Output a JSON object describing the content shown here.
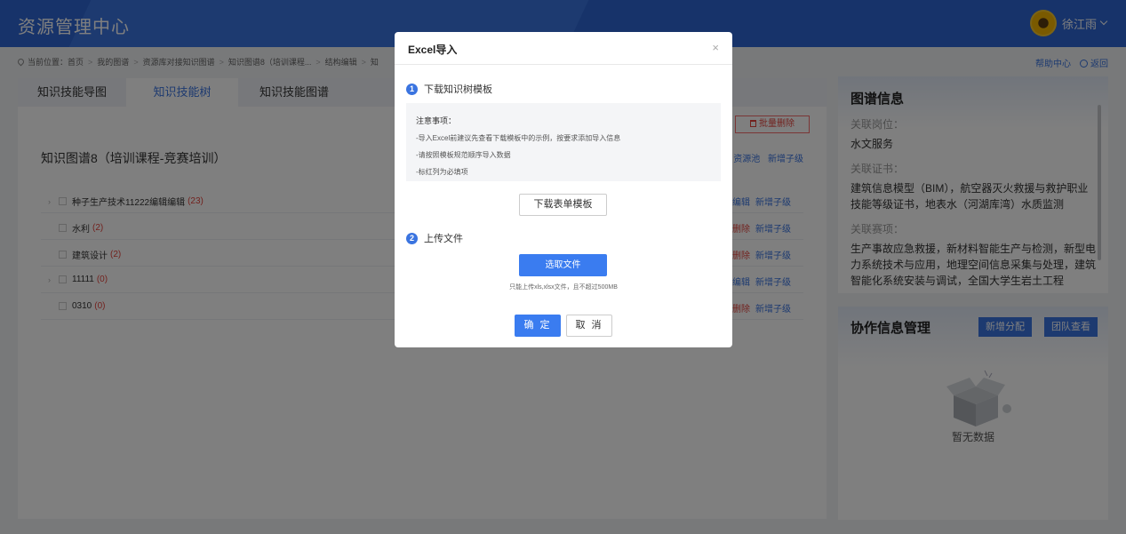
{
  "app": {
    "title": "资源管理中心",
    "user": "徐江雨"
  },
  "breadcrumb": {
    "label": "当前位置：",
    "items": [
      "首页",
      "我的图谱",
      "资源库对接知识图谱",
      "知识图谱8（培训课程...",
      "结构编辑",
      "知"
    ]
  },
  "toplinks": {
    "help": "帮助中心",
    "back": "返回"
  },
  "tabs": [
    {
      "label": "知识技能导图"
    },
    {
      "label": "知识技能树"
    },
    {
      "label": "知识技能图谱"
    }
  ],
  "main": {
    "map_title": "知识图谱8（培训课程-竞赛培训）",
    "batch_delete": "批量删除",
    "header_actions": {
      "pool": "资源池",
      "add_child": "新增子级"
    },
    "rows": [
      {
        "name": "种子生产技术11222编辑编辑",
        "count": "(23)",
        "expand": "›",
        "op1": "编辑",
        "op2": "新增子级"
      },
      {
        "name": "水利",
        "count": "(2)",
        "expand": "",
        "op1": "删除",
        "op2": "新增子级"
      },
      {
        "name": "建筑设计",
        "count": "(2)",
        "expand": "",
        "op1": "删除",
        "op2": "新增子级"
      },
      {
        "name": "11111",
        "count": "(0)",
        "expand": "›",
        "op1": "编辑",
        "op2": "新增子级"
      },
      {
        "name": "0310",
        "count": "(0)",
        "expand": "",
        "op1": "删除",
        "op2": "新增子级"
      }
    ]
  },
  "graph_info": {
    "title": "图谱信息",
    "post_label": "关联岗位：",
    "post_value": "水文服务",
    "cert_label": "关联证书：",
    "cert_value": "建筑信息模型（BIM），航空器灭火救援与救护职业技能等级证书，地表水（河湖库湾）水质监测",
    "contest_label": "关联赛项：",
    "contest_value": "生产事故应急救援，新材料智能生产与检测，新型电力系统技术与应用，地理空间信息采集与处理，建筑智能化系统安装与调试，全国大学生岩土工程"
  },
  "collab": {
    "title": "协作信息管理",
    "btn_assign": "新增分配",
    "btn_team": "团队查看",
    "empty": "暂无数据"
  },
  "modal": {
    "title": "Excel导入",
    "close": "×",
    "step1_num": "1",
    "step1": "下载知识树模板",
    "notes_title": "注意事项：",
    "notes": [
      "-导入Excel前建议先查看下载模板中的示例，按要求添加导入信息",
      "-请按照模板规范顺序导入数据",
      "-标红列为必填项"
    ],
    "download_btn": "下载表单模板",
    "step2_num": "2",
    "step2": "上传文件",
    "pick_btn": "选取文件",
    "hint": "只能上传xls,xlsx文件，且不超过500MB",
    "ok": "确 定",
    "cancel": "取 消"
  }
}
